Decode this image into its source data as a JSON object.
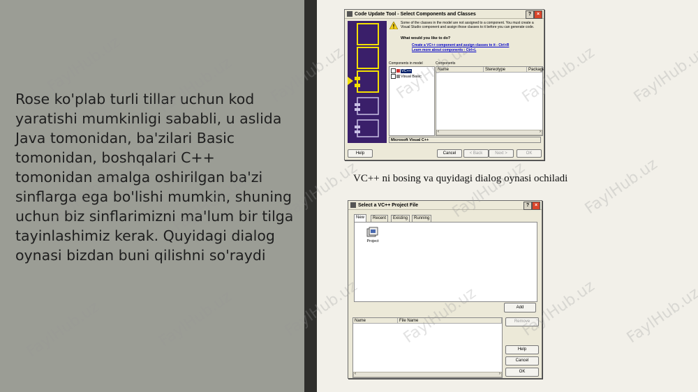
{
  "slide": {
    "paragraph": "Rose ko'plab turli tillar uchun kod yaratishi mumkinligi sababli, u aslida Java tomonidan, ba'zilari Basic tomonidan, boshqalari C++ tomonidan amalga oshirilgan ba'zi sinflarga ega bo'lishi mumkin, shuning uchun biz sinflarimizni ma'lum bir tilga tayinlashimiz kerak. Quyidagi dialog oynasi bizdan buni qilishni so'raydi",
    "caption": "VC++ ni bosing va quyidagi dialog oynasi ochiladi",
    "watermark": "FaylHub.uz"
  },
  "dialog1": {
    "title": "Code Update Tool - Select Components and Classes",
    "message": "Some of the classes in the model are not assigned to a component. You must create a Visual Studio component and assign those classes to it before you can generate code.",
    "question": "What would you like to do?",
    "link1": "Create a VC++ component and assign classes to it - Ctrl+R",
    "link2": "Learn more about components - Ctrl+L",
    "components_in_model_label": "Components in model",
    "tree_item1": "VC++",
    "tree_item2": "Visual Basic",
    "components_label": "Components",
    "col_name": "Name",
    "col_stereotype": "Stereotype",
    "col_package": "Package",
    "status_text": "Microsoft Visual C++",
    "help": "Help",
    "cancel": "Cancel",
    "back": "< Back",
    "next": "Next >",
    "ok": "OK"
  },
  "dialog2": {
    "title": "Select a VC++ Project File",
    "tabs": [
      "New",
      "Recent",
      "Existing",
      "Running"
    ],
    "project_label": "Project",
    "add": "Add",
    "col_name": "Name",
    "col_filename": "File Name",
    "remove": "Remove",
    "help": "Help",
    "cancel": "Cancel",
    "ok": "OK"
  }
}
